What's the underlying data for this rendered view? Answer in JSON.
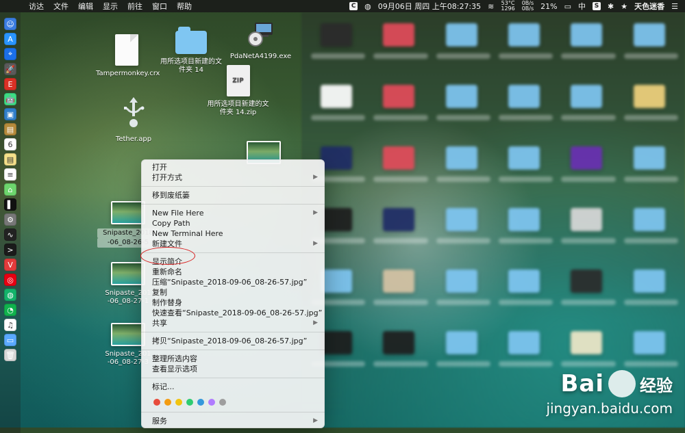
{
  "menubar": {
    "app_name": "访达",
    "menus": [
      "文件",
      "编辑",
      "显示",
      "前往",
      "窗口",
      "帮助"
    ],
    "status": {
      "c_badge": "C",
      "datetime": "09月06日 周四 上午08:27:35",
      "temp_top": "53°C",
      "temp_bottom": "1296",
      "net_up": "0B/s",
      "net_down": "0B/s",
      "battery": "21%",
      "input_method": "中",
      "s_badge": "S",
      "username": "天色迷香"
    }
  },
  "dock": {
    "apps": [
      {
        "name": "finder-icon",
        "color": "#3b7de1",
        "glyph": "☺"
      },
      {
        "name": "appstore-icon",
        "color": "#2a95ff",
        "glyph": "A"
      },
      {
        "name": "safari-icon",
        "color": "#1b6fe8",
        "glyph": "⌖"
      },
      {
        "name": "launchpad-icon",
        "color": "#5a5a5a",
        "glyph": "🚀"
      },
      {
        "name": "red-app-icon",
        "color": "#d93025",
        "glyph": "E"
      },
      {
        "name": "android-icon",
        "color": "#3ddc84",
        "glyph": "🤖"
      },
      {
        "name": "preview-icon",
        "color": "#2f7ec9",
        "glyph": "▣"
      },
      {
        "name": "notes-icon",
        "color": "#b58a3b",
        "glyph": "▤"
      },
      {
        "name": "calendar-icon",
        "color": "#ffffff",
        "glyph": "6"
      },
      {
        "name": "stickies-icon",
        "color": "#f5e08a",
        "glyph": "▤"
      },
      {
        "name": "textedit-icon",
        "color": "#ffffff",
        "glyph": "≡"
      },
      {
        "name": "maps-icon",
        "color": "#6dd66d",
        "glyph": "⌂"
      },
      {
        "name": "terminal-dark-icon",
        "color": "#111111",
        "glyph": "▌"
      },
      {
        "name": "settings-icon",
        "color": "#777777",
        "glyph": "⚙"
      },
      {
        "name": "activity-monitor-icon",
        "color": "#222222",
        "glyph": "∿"
      },
      {
        "name": "terminal-icon",
        "color": "#1a1a1a",
        "glyph": ">"
      },
      {
        "name": "vivaldi-icon",
        "color": "#e23b3b",
        "glyph": "V"
      },
      {
        "name": "netease-icon",
        "color": "#e60012",
        "glyph": "◎"
      },
      {
        "name": "wechat-work-icon",
        "color": "#13b36a",
        "glyph": "◍"
      },
      {
        "name": "wechat-icon",
        "color": "#10b24d",
        "glyph": "◔"
      },
      {
        "name": "music-icon",
        "color": "#ffffff",
        "glyph": "♫"
      },
      {
        "name": "downloads-folder-icon",
        "color": "#5aa9ff",
        "glyph": "▭"
      },
      {
        "name": "trash-icon",
        "color": "#d7d7d7",
        "glyph": "🗑"
      }
    ]
  },
  "desktop": {
    "items": [
      {
        "id": "tampermonkey",
        "label": "Tampermonkey.crx"
      },
      {
        "id": "folder14",
        "label_line1": "用所选项目新建的文",
        "label_line2": "件夹 14"
      },
      {
        "id": "pda",
        "label": "PdaNetA4199.exe"
      },
      {
        "id": "zip14",
        "label_line1": "用所选项目新建的文",
        "label_line2": "件夹 14.zip",
        "zip_text": "ZIP"
      },
      {
        "id": "tether",
        "label": "Tether.app"
      },
      {
        "id": "snip1",
        "label_line1": "Snipaste_2018",
        "label_line2": "-06_08-26-5"
      },
      {
        "id": "snip2",
        "label_line1": "Snipaste_201",
        "label_line2": "-06_08-27-1"
      },
      {
        "id": "snip3",
        "label_line1": "Snipaste_201",
        "label_line2": "-06_08-27-3"
      }
    ]
  },
  "context_menu": {
    "items": [
      {
        "label": "打开",
        "arrow": false
      },
      {
        "label": "打开方式",
        "arrow": true
      },
      {
        "sep": true
      },
      {
        "label": "移到废纸篓",
        "arrow": false
      },
      {
        "sep": true
      },
      {
        "label": "New File Here",
        "arrow": true
      },
      {
        "label": "Copy Path",
        "arrow": false
      },
      {
        "label": "New Terminal Here",
        "arrow": false
      },
      {
        "label": "新建文件",
        "arrow": true
      },
      {
        "sep": true
      },
      {
        "label": "显示简介",
        "arrow": false,
        "highlight": true
      },
      {
        "label": "重新命名",
        "arrow": false
      },
      {
        "label": "压缩“Snipaste_2018-09-06_08-26-57.jpg”",
        "arrow": false
      },
      {
        "label": "复制",
        "arrow": false
      },
      {
        "label": "制作替身",
        "arrow": false
      },
      {
        "label": "快速查看“Snipaste_2018-09-06_08-26-57.jpg”",
        "arrow": false
      },
      {
        "label": "共享",
        "arrow": true
      },
      {
        "sep": true
      },
      {
        "label": "拷贝“Snipaste_2018-09-06_08-26-57.jpg”",
        "arrow": false
      },
      {
        "sep": true
      },
      {
        "label": "整理所选内容",
        "arrow": false
      },
      {
        "label": "查看显示选项",
        "arrow": false
      },
      {
        "sep": true
      },
      {
        "label": "标记...",
        "arrow": false
      },
      {
        "tags": [
          "#e74c3c",
          "#f39c12",
          "#f1c40f",
          "#2ecc71",
          "#3498db",
          "#b07cff",
          "#9e9e9e"
        ]
      },
      {
        "sep": true
      },
      {
        "label": "服务",
        "arrow": true
      }
    ]
  },
  "watermark": {
    "brand": "Bai",
    "brand_suffix": "经验",
    "url": "jingyan.baidu.com"
  }
}
